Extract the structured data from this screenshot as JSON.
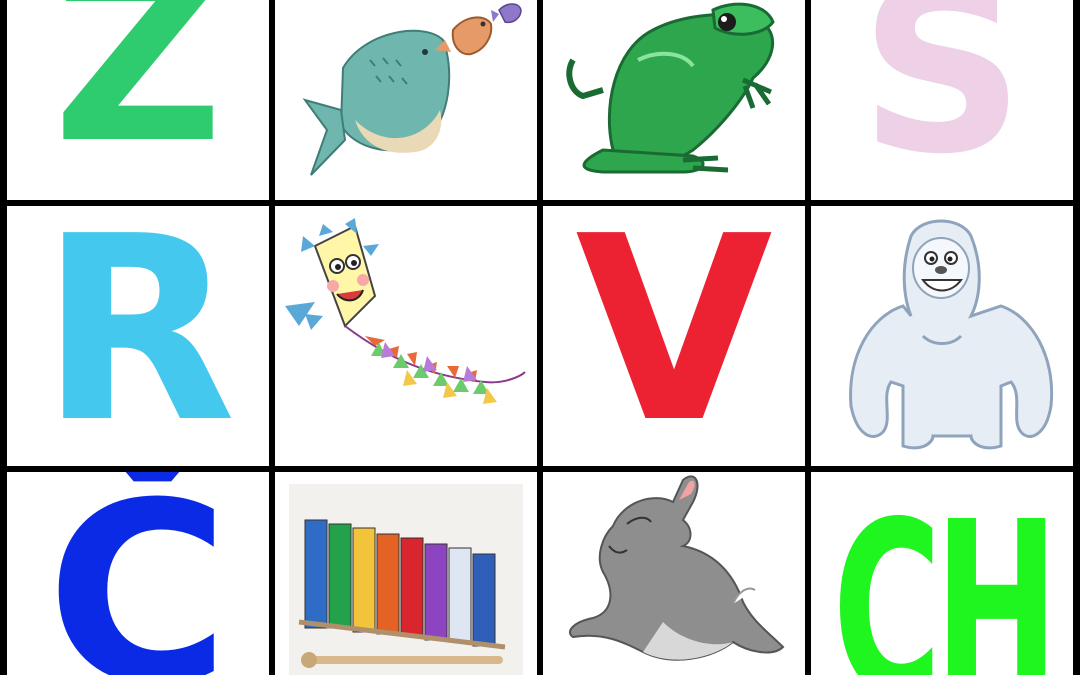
{
  "grid": {
    "rows": 3,
    "columns": 4,
    "cells": [
      {
        "type": "letter",
        "text": "Z",
        "color": "#2ECC6E"
      },
      {
        "type": "picture",
        "icon": "fish-icon"
      },
      {
        "type": "picture",
        "icon": "frog-icon"
      },
      {
        "type": "letter",
        "text": "S",
        "color": "#EED1E6"
      },
      {
        "type": "letter",
        "text": "R",
        "color": "#45C8EE"
      },
      {
        "type": "picture",
        "icon": "kite-icon"
      },
      {
        "type": "letter",
        "text": "V",
        "color": "#EC2232"
      },
      {
        "type": "picture",
        "icon": "yeti-icon"
      },
      {
        "type": "letter",
        "text": "Č",
        "color": "#0A2AE6"
      },
      {
        "type": "picture",
        "icon": "xylophone-icon"
      },
      {
        "type": "picture",
        "icon": "hare-icon"
      },
      {
        "type": "letter",
        "text": "CH",
        "colors": [
          "#55F560",
          "#1FF51F"
        ]
      }
    ]
  }
}
